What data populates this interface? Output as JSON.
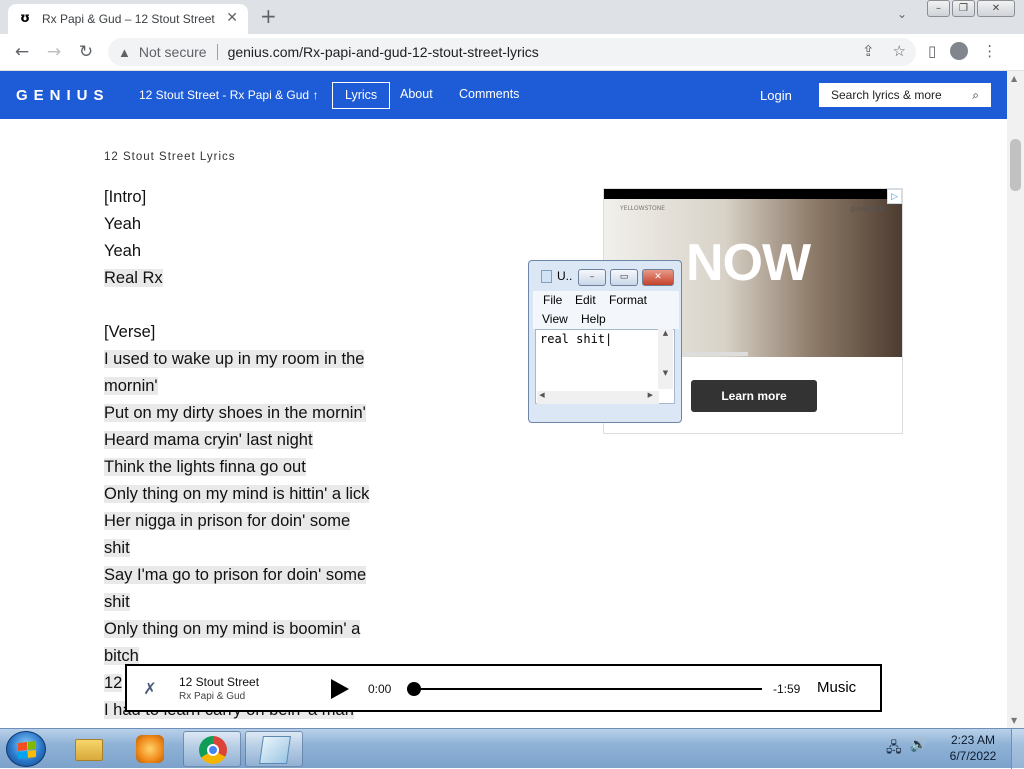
{
  "browser": {
    "tab": {
      "favicon_icon": "genius-g-icon",
      "title": "Rx Papi & Gud – 12 Stout Street"
    },
    "security_label": "Not secure",
    "url": "genius.com/Rx-papi-and-gud-12-stout-street-lyrics"
  },
  "genius_nav": {
    "logo": "GENIUS",
    "song_title": "12 Stout Street - Rx Papi & Gud",
    "tabs": [
      {
        "label": "Lyrics",
        "active": true
      },
      {
        "label": "About",
        "active": false
      },
      {
        "label": "Comments",
        "active": false
      }
    ],
    "login": "Login",
    "search_placeholder": "Search lyrics & more"
  },
  "lyrics": {
    "heading": "12 Stout Street Lyrics",
    "lines": [
      {
        "text": "[Intro]",
        "hl": false
      },
      {
        "text": "Yeah",
        "hl": false
      },
      {
        "text": "Yeah",
        "hl": false
      },
      {
        "text": "Real Rx",
        "hl": true
      },
      {
        "text": "",
        "hl": false
      },
      {
        "text": "[Verse]",
        "hl": false
      },
      {
        "text": "I used to wake up in my room in the",
        "hl": true
      },
      {
        "text": "mornin'",
        "hl": true
      },
      {
        "text": "Put on my dirty shoes in the mornin'",
        "hl": true
      },
      {
        "text": "Heard mama cryin' last night",
        "hl": true
      },
      {
        "text": "Think the lights finna go out",
        "hl": true
      },
      {
        "text": "Only thing on my mind is hittin' a lick",
        "hl": true
      },
      {
        "text": "Her nigga in prison for doin' some",
        "hl": true
      },
      {
        "text": "shit",
        "hl": true
      },
      {
        "text": "Say I'ma go to prison for doin' some",
        "hl": true
      },
      {
        "text": "shit",
        "hl": true
      },
      {
        "text": "Only thing on my mind is boomin' a",
        "hl": true
      },
      {
        "text": "bitch",
        "hl": true
      },
      {
        "text": "12",
        "hl": true
      },
      {
        "text": "I had to learn carry on bein' a man",
        "hl": true
      }
    ]
  },
  "ad": {
    "show_label": "YELLOWSTONE",
    "brand": "peacock",
    "headline": "NOW",
    "cta": "Learn more",
    "badge_icon": "adchoices-icon"
  },
  "notepad": {
    "title": "U..",
    "menu": [
      "File",
      "Edit",
      "Format",
      "View",
      "Help"
    ],
    "content": "real shit"
  },
  "player": {
    "song": "12 Stout Street",
    "artist": "Rx Papi & Gud",
    "current_time": "0:00",
    "remaining_time": "-1:59",
    "progress": 0,
    "brand": "Music"
  },
  "taskbar": {
    "apps": [
      "windows-explorer-icon",
      "media-player-icon",
      "chrome-icon",
      "notepad-icon"
    ],
    "time": "2:23 AM",
    "date": "6/7/2022"
  }
}
